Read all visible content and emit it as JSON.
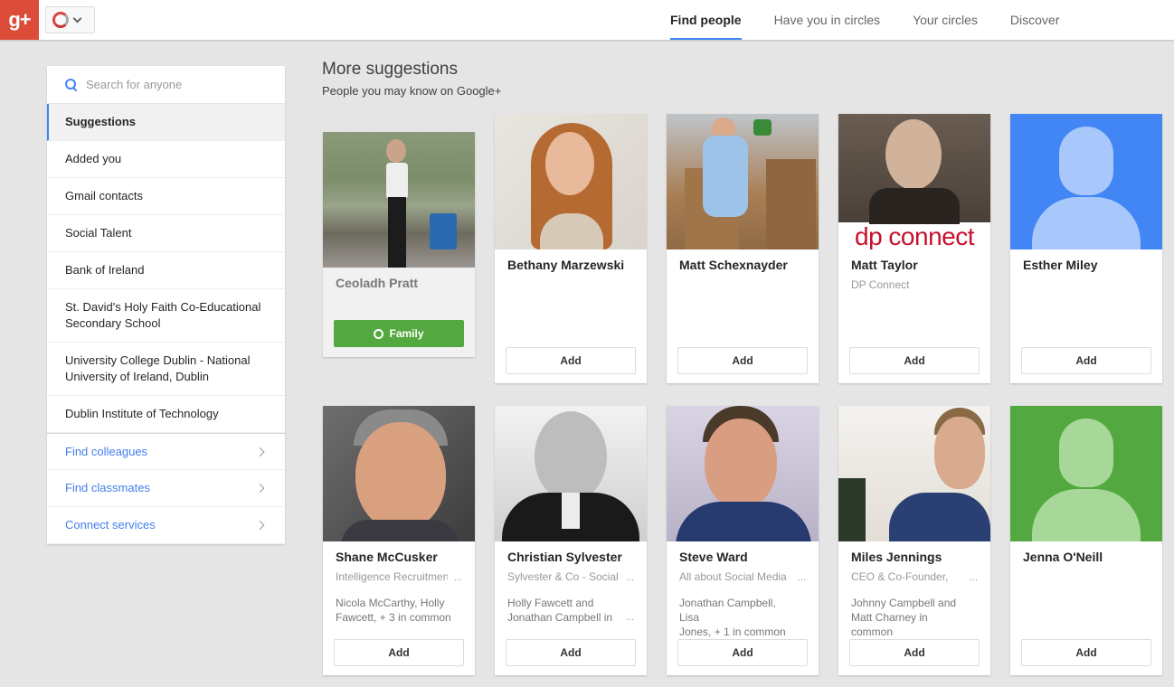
{
  "topbar": {
    "logo_text": "g+",
    "tabs": [
      {
        "label": "Find people",
        "active": true
      },
      {
        "label": "Have you in circles",
        "active": false
      },
      {
        "label": "Your circles",
        "active": false
      },
      {
        "label": "Discover",
        "active": false
      }
    ]
  },
  "sidebar": {
    "search_placeholder": "Search for anyone",
    "items": [
      {
        "label": "Suggestions"
      },
      {
        "label": "Added you"
      },
      {
        "label": "Gmail contacts"
      },
      {
        "label": "Social Talent"
      },
      {
        "label": "Bank of Ireland"
      },
      {
        "label": "St. David's Holy Faith Co-Educational Secondary School"
      },
      {
        "label": "University College Dublin - National University of Ireland, Dublin"
      },
      {
        "label": "Dublin Institute of Technology"
      }
    ],
    "links": [
      {
        "label": "Find colleagues"
      },
      {
        "label": "Find classmates"
      },
      {
        "label": "Connect services"
      }
    ]
  },
  "main": {
    "title": "More suggestions",
    "subtitle": "People you may know on Google+"
  },
  "people": [
    {
      "name": "Ceoladh Pratt",
      "circle_label": "Family"
    },
    {
      "name": "Bethany Marzewski",
      "add_label": "Add"
    },
    {
      "name": "Matt Schexnayder",
      "add_label": "Add"
    },
    {
      "name": "Matt Taylor",
      "subtitle": "DP Connect",
      "logo_text": "dp connect",
      "add_label": "Add"
    },
    {
      "name": "Esther Miley",
      "add_label": "Add"
    },
    {
      "name": "Shane McCusker",
      "subtitle": "Intelligence Recruitment",
      "dots": "...",
      "mutual_a": "Nicola McCarthy, Holly",
      "mutual_b": "Fawcett, + 3 in common",
      "add_label": "Add"
    },
    {
      "name": "Christian Sylvester",
      "subtitle": "Sylvester & Co - Social",
      "dots": "...",
      "mutual_a": "Holly Fawcett and",
      "mutual_b": "Jonathan Campbell in",
      "add_label": "Add"
    },
    {
      "name": "Steve Ward",
      "subtitle": "All about Social Media",
      "dots": "...",
      "mutual_a": "Jonathan Campbell, Lisa",
      "mutual_b": "Jones, + 1 in common",
      "add_label": "Add"
    },
    {
      "name": "Miles Jennings",
      "subtitle": "CEO & Co-Founder,",
      "dots": "...",
      "mutual_a": "Johnny Campbell and",
      "mutual_b": "Matt Charney in common",
      "add_label": "Add"
    },
    {
      "name": "Jenna O'Neill",
      "add_label": "Add"
    }
  ],
  "colors": {
    "gplus_red": "#dd4b39",
    "accent_blue": "#4285f4",
    "family_green": "#53a93f",
    "silhouette_blue_bg": "#4285f4",
    "silhouette_green_bg": "#53a93f"
  }
}
